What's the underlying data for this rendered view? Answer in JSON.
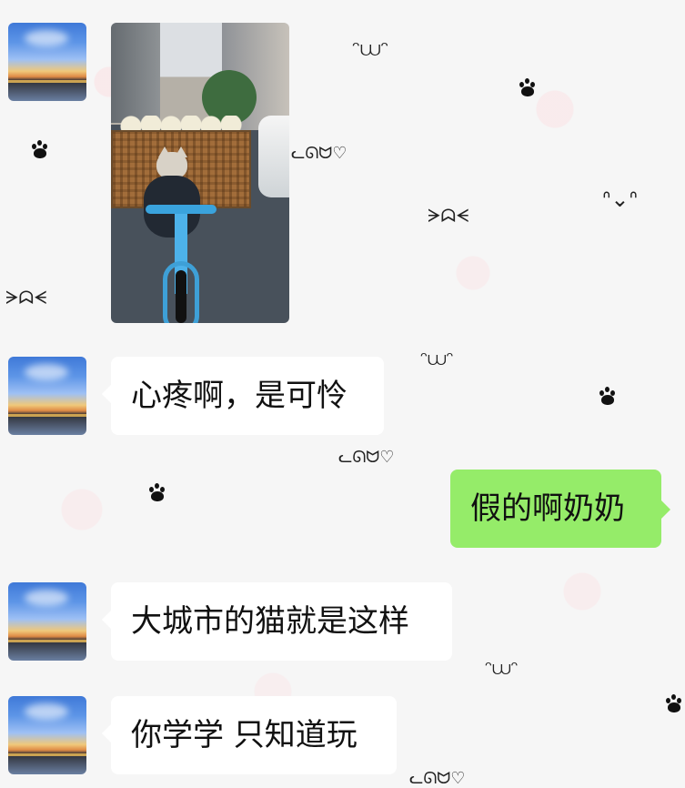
{
  "chat": {
    "messages": [
      {
        "side": "left",
        "type": "image",
        "avatar": "sunset-avatar"
      },
      {
        "side": "left",
        "type": "text",
        "text": "心疼啊，是可怜",
        "avatar": "sunset-avatar"
      },
      {
        "side": "right",
        "type": "text",
        "text": "假的啊奶奶"
      },
      {
        "side": "left",
        "type": "text",
        "text": "大城市的猫就是这样",
        "avatar": "sunset-avatar"
      },
      {
        "side": "left",
        "type": "text",
        "text": "你学学 只知道玩",
        "avatar": "sunset-avatar"
      }
    ],
    "colors": {
      "wallpaper": "#f6f6f6",
      "incoming_bubble": "#ffffff",
      "outgoing_bubble": "#95ec69"
    },
    "icons": {
      "avatar": "sunset-avatar",
      "photo": "cat-on-bicycle-photo",
      "paw": "paw-print-icon"
    }
  }
}
